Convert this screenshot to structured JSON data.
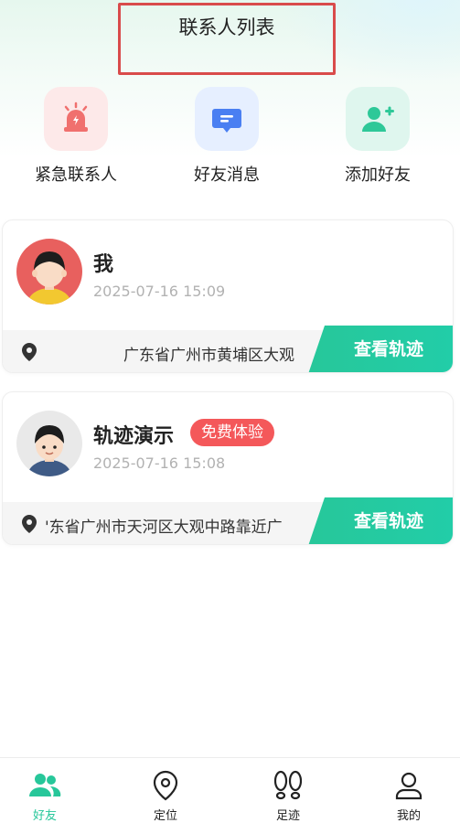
{
  "header": {
    "title": "联系人列表"
  },
  "quick_actions": [
    {
      "label": "紧急联系人",
      "icon": "alarm-light-icon",
      "color": "#f0706e"
    },
    {
      "label": "好友消息",
      "icon": "message-icon",
      "color": "#4a7ff2"
    },
    {
      "label": "添加好友",
      "icon": "add-user-icon",
      "color": "#2ec898"
    }
  ],
  "contacts": [
    {
      "name": "我",
      "badge": "",
      "time": "2025-07-16 15:09",
      "address": "广东省广州市黄埔区大观",
      "button": "查看轨迹"
    },
    {
      "name": "轨迹演示",
      "badge": "免费体验",
      "time": "2025-07-16 15:08",
      "address": "'东省广州市天河区大观中路靠近广",
      "button": "查看轨迹"
    }
  ],
  "tabbar": {
    "active": "好友",
    "items": [
      {
        "label": "好友",
        "icon": "friends-icon"
      },
      {
        "label": "定位",
        "icon": "location-pin-icon"
      },
      {
        "label": "足迹",
        "icon": "footprints-icon"
      },
      {
        "label": "我的",
        "icon": "profile-icon"
      }
    ]
  },
  "colors": {
    "accent": "#27c79a",
    "badge": "#f4585a",
    "title_highlight": "#d94b4b"
  }
}
